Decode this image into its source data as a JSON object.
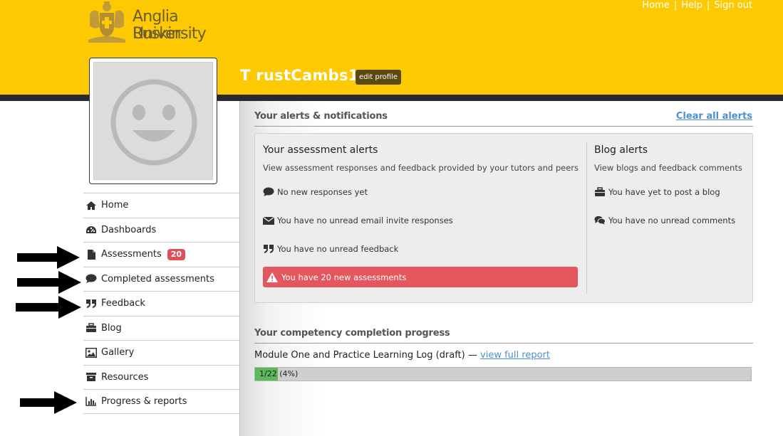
{
  "header": {
    "logo_line1": "Anglia Ruskin",
    "logo_line2": "University",
    "links": [
      "Home",
      "Help",
      "Sign out"
    ],
    "username": "T rustCambs1",
    "edit_profile": "edit profile",
    "brand_color": "#fdc903"
  },
  "nav": {
    "items": [
      {
        "label": "Home",
        "icon": "home-icon"
      },
      {
        "label": "Dashboards",
        "icon": "dashboard-icon"
      },
      {
        "label": "Assessments",
        "icon": "file-icon",
        "badge": "20"
      },
      {
        "label": "Completed assessments",
        "icon": "comment-icon"
      },
      {
        "label": "Feedback",
        "icon": "quote-icon"
      },
      {
        "label": "Blog",
        "icon": "briefcase-icon"
      },
      {
        "label": "Gallery",
        "icon": "image-icon"
      },
      {
        "label": "Resources",
        "icon": "archive-icon"
      },
      {
        "label": "Progress & reports",
        "icon": "bar-chart-icon"
      }
    ]
  },
  "alerts": {
    "title": "Your alerts & notifications",
    "clear_all": "Clear all alerts",
    "assessment": {
      "heading": "Your assessment alerts",
      "subheading": "View assessment responses and feedback provided by your tutors and peers",
      "items": [
        "No new responses yet",
        "You have no unread email invite responses",
        "You have no unread feedback"
      ],
      "danger": "You have 20 new assessments"
    },
    "blog": {
      "heading": "Blog alerts",
      "subheading": "View blogs and feedback comments",
      "items": [
        "You have yet to post a blog",
        "You have no unread comments"
      ]
    }
  },
  "progress": {
    "title": "Your competency completion progress",
    "module": "Module One and Practice Learning Log (draft)",
    "dash": "—",
    "report_link": "view full report",
    "completed": 1,
    "total": 22,
    "fraction_text": "1/22",
    "percent_text": "(4%)",
    "percent": 4
  }
}
